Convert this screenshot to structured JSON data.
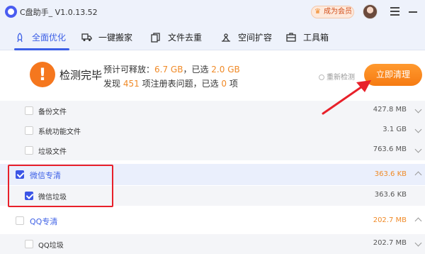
{
  "window": {
    "title": "C盘助手_ V1.0.13.52",
    "vip_label": "成为会员"
  },
  "tabs": [
    {
      "label": "全面优化",
      "icon": "rocket-icon",
      "active": true
    },
    {
      "label": "一键搬家",
      "icon": "truck-icon",
      "active": false
    },
    {
      "label": "文件去重",
      "icon": "files-icon",
      "active": false
    },
    {
      "label": "空间扩容",
      "icon": "expand-icon",
      "active": false
    },
    {
      "label": "工具箱",
      "icon": "toolbox-icon",
      "active": false
    }
  ],
  "scan": {
    "status_icon": "!",
    "title": "检测完毕",
    "line1": {
      "prefix": "预计可释放：",
      "releasable": "6.7 GB",
      "mid": "，已选",
      "selected": "2.0 GB"
    },
    "line2": {
      "prefix": "发现",
      "issues": "451",
      "mid": "项注册表问题，已选",
      "selected": "0",
      "suffix": "项"
    },
    "rescan_label": "重新检测",
    "clean_button": "立即清理"
  },
  "list": [
    {
      "type": "sub",
      "label": "备份文件",
      "size": "427.8 MB",
      "checked": false
    },
    {
      "type": "sub",
      "label": "系统功能文件",
      "size": "3.1 GB",
      "checked": false
    },
    {
      "type": "sub",
      "label": "垃圾文件",
      "size": "763.6 MB",
      "checked": false
    },
    {
      "type": "group",
      "label": "微信专清",
      "size": "363.6 KB",
      "checked": true,
      "expanded": true
    },
    {
      "type": "sub",
      "label": "微信垃圾",
      "size": "363.6 KB",
      "checked": true
    },
    {
      "type": "group",
      "label": "QQ专清",
      "size": "202.7 MB",
      "checked": false,
      "expanded": true
    },
    {
      "type": "sub",
      "label": "QQ垃圾",
      "size": "202.7 MB",
      "checked": false
    }
  ],
  "colors": {
    "accent": "#3c5fe6",
    "orange": "#f08a27",
    "annotation": "#e8202a"
  }
}
